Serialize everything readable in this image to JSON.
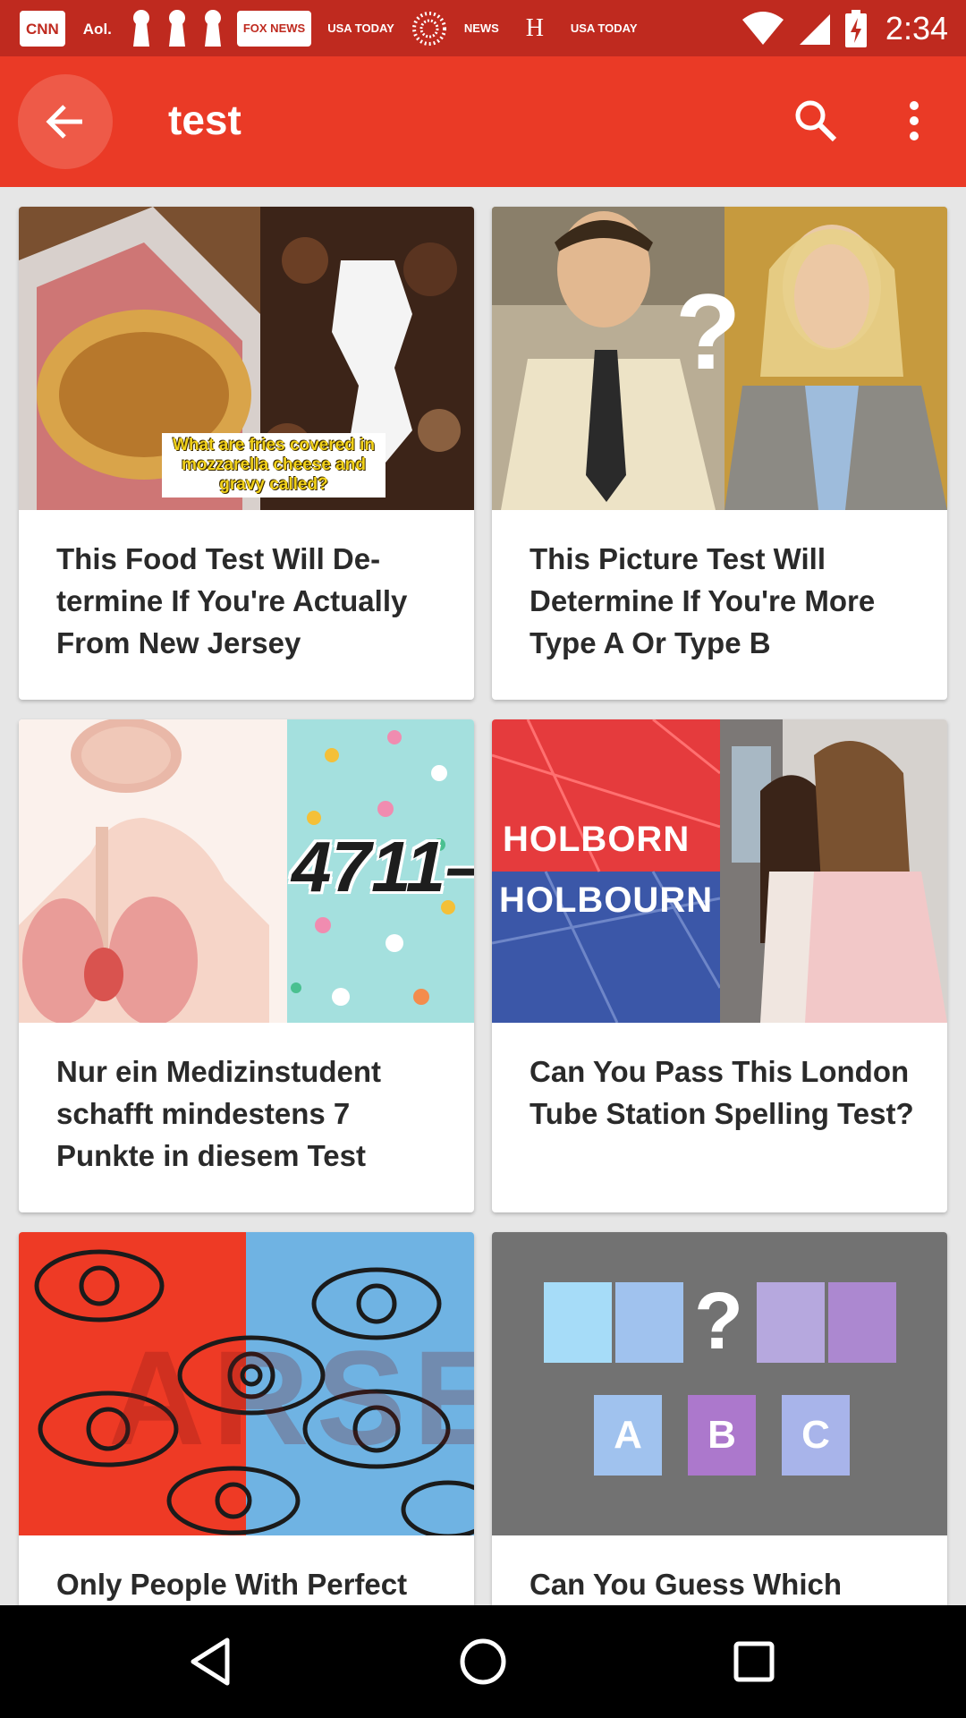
{
  "status_bar": {
    "notifications": [
      "CNN",
      "Aol.",
      "FOX NEWS",
      "USA TODAY",
      "NEWS",
      "H",
      "USA TODAY"
    ],
    "time": "2:34"
  },
  "app_bar": {
    "title": "test",
    "back_icon": "arrow-back-icon",
    "search_icon": "search-icon",
    "menu_icon": "more-vert-icon",
    "color": "#ea3a26"
  },
  "cards": [
    {
      "title": "This Food Test Will De-termine If You're Actually From New Jersey",
      "image_caption": "What are fries covered in mozzarella cheese and gravy called?"
    },
    {
      "title": "This Picture Test Will Determine If You're More Type A Or Type B",
      "image_text": "?"
    },
    {
      "title": "Nur ein Medizinstudent schafft mindestens 7 Punkte in diesem Test",
      "image_text": "4711–"
    },
    {
      "title": "Can You Pass This London Tube Station Spelling Test?",
      "image_text_1": "HOLBORN",
      "image_text_2": "HOLBOURN"
    },
    {
      "title": "Only People With Perfect",
      "image_text": "ARSE"
    },
    {
      "title": "Can You Guess Which",
      "image_letters": [
        "A",
        "B",
        "C"
      ],
      "image_text": "?"
    }
  ],
  "nav_bar": {
    "back_icon": "triangle-back-icon",
    "home_icon": "circle-home-icon",
    "recents_icon": "square-recents-icon"
  }
}
